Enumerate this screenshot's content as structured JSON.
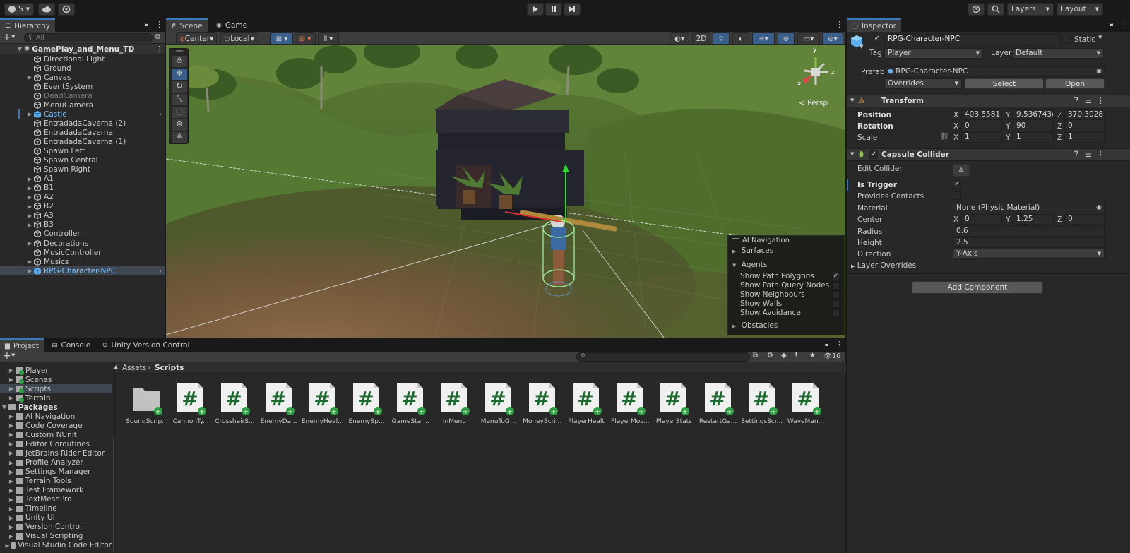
{
  "toolbar": {
    "account_label": "S",
    "layers_label": "Layers",
    "layout_label": "Layout"
  },
  "hierarchy": {
    "tab_label": "Hierarchy",
    "search_placeholder": "All",
    "scene_name": "GamePlay_and_Menu_TD",
    "items": [
      {
        "label": "Directional Light",
        "expandable": false,
        "dim": false,
        "selected": false,
        "prefab": false
      },
      {
        "label": "Ground",
        "expandable": false,
        "dim": false,
        "selected": false,
        "prefab": false
      },
      {
        "label": "Canvas",
        "expandable": true,
        "dim": false,
        "selected": false,
        "prefab": false
      },
      {
        "label": "EventSystem",
        "expandable": false,
        "dim": false,
        "selected": false,
        "prefab": false
      },
      {
        "label": "DeadCamera",
        "expandable": false,
        "dim": true,
        "selected": false,
        "prefab": false
      },
      {
        "label": "MenuCamera",
        "expandable": false,
        "dim": false,
        "selected": false,
        "prefab": false
      },
      {
        "label": "Castle",
        "expandable": true,
        "dim": false,
        "selected": false,
        "prefab": true
      },
      {
        "label": "EntradadaCaverna (2)",
        "expandable": false,
        "dim": false,
        "selected": false,
        "prefab": false
      },
      {
        "label": "EntradadaCaverna",
        "expandable": false,
        "dim": false,
        "selected": false,
        "prefab": false
      },
      {
        "label": "EntradadaCaverna (1)",
        "expandable": false,
        "dim": false,
        "selected": false,
        "prefab": false
      },
      {
        "label": "Spawn Left",
        "expandable": false,
        "dim": false,
        "selected": false,
        "prefab": false
      },
      {
        "label": "Spawn Central",
        "expandable": false,
        "dim": false,
        "selected": false,
        "prefab": false
      },
      {
        "label": "Spawn Right",
        "expandable": false,
        "dim": false,
        "selected": false,
        "prefab": false
      },
      {
        "label": "A1",
        "expandable": true,
        "dim": false,
        "selected": false,
        "prefab": false
      },
      {
        "label": "B1",
        "expandable": true,
        "dim": false,
        "selected": false,
        "prefab": false
      },
      {
        "label": "A2",
        "expandable": true,
        "dim": false,
        "selected": false,
        "prefab": false
      },
      {
        "label": "B2",
        "expandable": true,
        "dim": false,
        "selected": false,
        "prefab": false
      },
      {
        "label": "A3",
        "expandable": true,
        "dim": false,
        "selected": false,
        "prefab": false
      },
      {
        "label": "B3",
        "expandable": true,
        "dim": false,
        "selected": false,
        "prefab": false
      },
      {
        "label": "Controller",
        "expandable": false,
        "dim": false,
        "selected": false,
        "prefab": false
      },
      {
        "label": "Decorations",
        "expandable": true,
        "dim": false,
        "selected": false,
        "prefab": false
      },
      {
        "label": "MusicController",
        "expandable": false,
        "dim": false,
        "selected": false,
        "prefab": false
      },
      {
        "label": "Musics",
        "expandable": true,
        "dim": false,
        "selected": false,
        "prefab": false
      },
      {
        "label": "RPG-Character-NPC",
        "expandable": true,
        "dim": false,
        "selected": true,
        "prefab": true
      }
    ]
  },
  "scene": {
    "tabs": [
      "Scene",
      "Game"
    ],
    "pivot_label": "Center",
    "space_label": "Local",
    "mode_2d": "2D",
    "persp_label": "< Persp",
    "gizmo_axes": {
      "x": "x",
      "y": "y",
      "z": "z"
    }
  },
  "ai_navigation": {
    "title": "AI Navigation",
    "sections": {
      "surfaces": "Surfaces",
      "agents": "Agents",
      "obstacles": "Obstacles"
    },
    "options": [
      {
        "label": "Show Path Polygons",
        "checked": true
      },
      {
        "label": "Show Path Query Nodes",
        "checked": false
      },
      {
        "label": "Show Neighbours",
        "checked": false
      },
      {
        "label": "Show Walls",
        "checked": false
      },
      {
        "label": "Show Avoidance",
        "checked": false
      }
    ]
  },
  "inspector": {
    "tab_label": "Inspector",
    "object_name": "RPG-Character-NPC",
    "static_label": "Static",
    "tag_label": "Tag",
    "tag_value": "Player",
    "layer_label": "Layer",
    "layer_value": "Default",
    "prefab_label": "Prefab",
    "prefab_value": "RPG-Character-NPC",
    "overrides_label": "Overrides",
    "select_label": "Select",
    "open_label": "Open",
    "transform": {
      "title": "Transform",
      "position_label": "Position",
      "rotation_label": "Rotation",
      "scale_label": "Scale",
      "position": {
        "x": "403.5581",
        "y": "9.536743e",
        "z": "370.3028"
      },
      "rotation": {
        "x": "0",
        "y": "90",
        "z": "0"
      },
      "scale": {
        "x": "1",
        "y": "1",
        "z": "1"
      }
    },
    "collider": {
      "title": "Capsule Collider",
      "edit_collider_label": "Edit Collider",
      "is_trigger_label": "Is Trigger",
      "is_trigger": true,
      "provides_contacts_label": "Provides Contacts",
      "material_label": "Material",
      "material_value": "None (Physic Material)",
      "center_label": "Center",
      "center": {
        "x": "0",
        "y": "1.25",
        "z": "0"
      },
      "radius_label": "Radius",
      "radius": "0.6",
      "height_label": "Height",
      "height": "2.5",
      "direction_label": "Direction",
      "direction": "Y-Axis"
    },
    "layer_overrides_label": "Layer Overrides",
    "add_component_label": "Add Component"
  },
  "project": {
    "tabs": [
      "Project",
      "Console",
      "Unity Version Control"
    ],
    "hidden_count": "16",
    "breadcrumb": {
      "root": "Assets",
      "current": "Scripts"
    },
    "tree": [
      {
        "label": "Player",
        "indent": 1,
        "selected": false,
        "bold": false
      },
      {
        "label": "Scenes",
        "indent": 1,
        "selected": false,
        "bold": false
      },
      {
        "label": "Scripts",
        "indent": 1,
        "selected": true,
        "bold": false
      },
      {
        "label": "Terrain",
        "indent": 1,
        "selected": false,
        "bold": false
      },
      {
        "label": "Packages",
        "indent": 0,
        "selected": false,
        "bold": true
      },
      {
        "label": "AI Navigation",
        "indent": 1,
        "selected": false,
        "bold": false
      },
      {
        "label": "Code Coverage",
        "indent": 1,
        "selected": false,
        "bold": false
      },
      {
        "label": "Custom NUnit",
        "indent": 1,
        "selected": false,
        "bold": false
      },
      {
        "label": "Editor Coroutines",
        "indent": 1,
        "selected": false,
        "bold": false
      },
      {
        "label": "JetBrains Rider Editor",
        "indent": 1,
        "selected": false,
        "bold": false
      },
      {
        "label": "Profile Analyzer",
        "indent": 1,
        "selected": false,
        "bold": false
      },
      {
        "label": "Settings Manager",
        "indent": 1,
        "selected": false,
        "bold": false
      },
      {
        "label": "Terrain Tools",
        "indent": 1,
        "selected": false,
        "bold": false
      },
      {
        "label": "Test Framework",
        "indent": 1,
        "selected": false,
        "bold": false
      },
      {
        "label": "TextMeshPro",
        "indent": 1,
        "selected": false,
        "bold": false
      },
      {
        "label": "Timeline",
        "indent": 1,
        "selected": false,
        "bold": false
      },
      {
        "label": "Unity UI",
        "indent": 1,
        "selected": false,
        "bold": false
      },
      {
        "label": "Version Control",
        "indent": 1,
        "selected": false,
        "bold": false
      },
      {
        "label": "Visual Scripting",
        "indent": 1,
        "selected": false,
        "bold": false
      },
      {
        "label": "Visual Studio Code Editor",
        "indent": 1,
        "selected": false,
        "bold": false
      }
    ],
    "assets": [
      {
        "label": "SoundScrip...",
        "kind": "folder"
      },
      {
        "label": "CannonTy...",
        "kind": "script"
      },
      {
        "label": "CrosshairS...",
        "kind": "script"
      },
      {
        "label": "EnemyDa...",
        "kind": "script"
      },
      {
        "label": "EnemyHeal...",
        "kind": "script"
      },
      {
        "label": "EnemySp...",
        "kind": "script"
      },
      {
        "label": "GameStar...",
        "kind": "script"
      },
      {
        "label": "InMenu",
        "kind": "script"
      },
      {
        "label": "MenuToG...",
        "kind": "script"
      },
      {
        "label": "MoneyScri...",
        "kind": "script"
      },
      {
        "label": "PlayerHealt",
        "kind": "script"
      },
      {
        "label": "PlayerMov...",
        "kind": "script"
      },
      {
        "label": "PlayerStats",
        "kind": "script"
      },
      {
        "label": "RestartGa...",
        "kind": "script"
      },
      {
        "label": "SettingsScr...",
        "kind": "script"
      },
      {
        "label": "WaveMan...",
        "kind": "script"
      }
    ]
  },
  "colors": {
    "accent": "#3a79bb",
    "selection": "#3e4651",
    "prefab_blue": "#5cb0f0",
    "script_green": "#2e8b3a"
  }
}
